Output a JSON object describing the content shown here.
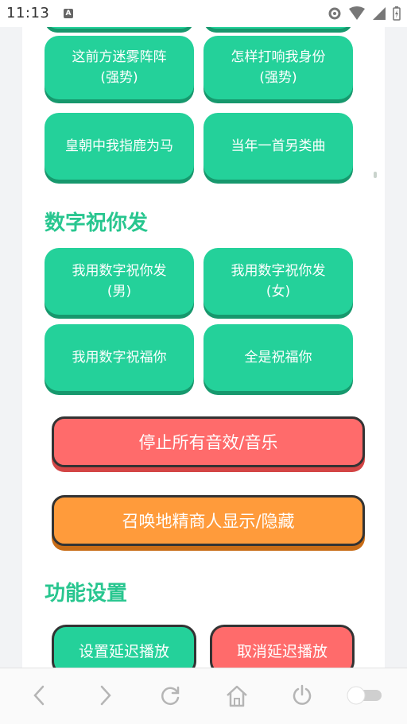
{
  "status_bar": {
    "time": "11:13",
    "notification_icon": "A"
  },
  "top_row": [
    {
      "line1": "这前方迷雾阵阵",
      "line2": "(强势)"
    },
    {
      "line1": "怎样打响我身份",
      "line2": "(强势)"
    }
  ],
  "row2": [
    {
      "label": "皇朝中我指鹿为马"
    },
    {
      "label": "当年一首另类曲"
    }
  ],
  "section1": {
    "title": "数字祝你发"
  },
  "row3": [
    {
      "line1": "我用数字祝你发",
      "line2": "(男)"
    },
    {
      "line1": "我用数字祝你发",
      "line2": "(女)"
    }
  ],
  "row4": [
    {
      "label": "我用数字祝福你"
    },
    {
      "label": "全是祝福你"
    }
  ],
  "stop_button": "停止所有音效/音乐",
  "summon_button": "召唤地精商人显示/隐藏",
  "section2": {
    "title": "功能设置"
  },
  "settings": {
    "set_delay": "设置延迟播放",
    "cancel_delay": "取消延迟播放"
  },
  "colors": {
    "green": "#24d19a",
    "heading_green": "#28c68f",
    "red": "#ff6b6b",
    "orange": "#ff9b3b"
  }
}
